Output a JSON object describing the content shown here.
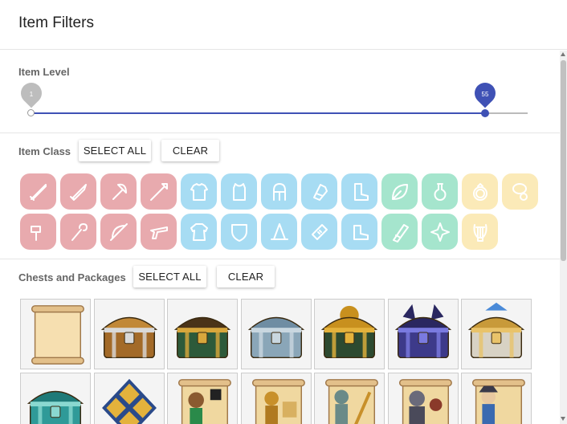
{
  "header": {
    "title": "Item Filters"
  },
  "item_level": {
    "label": "Item Level",
    "min_value": "1",
    "max_value": "55",
    "range_min": 1,
    "range_max": 60
  },
  "item_class": {
    "label": "Item Class",
    "select_all": "SELECT ALL",
    "clear": "CLEAR",
    "icons": [
      {
        "name": "sword-icon",
        "color": "red"
      },
      {
        "name": "dagger-icon",
        "color": "red"
      },
      {
        "name": "axe-icon",
        "color": "red"
      },
      {
        "name": "spear-icon",
        "color": "red"
      },
      {
        "name": "chest-armor-icon",
        "color": "blue"
      },
      {
        "name": "vest-icon",
        "color": "blue"
      },
      {
        "name": "helmet-icon",
        "color": "blue"
      },
      {
        "name": "gauntlet-icon",
        "color": "blue"
      },
      {
        "name": "boot-icon",
        "color": "blue"
      },
      {
        "name": "leaf-icon",
        "color": "green"
      },
      {
        "name": "potion-icon",
        "color": "green"
      },
      {
        "name": "ring-icon",
        "color": "yellow"
      },
      {
        "name": "amulet-icon",
        "color": "yellow"
      },
      {
        "name": "hammer-icon",
        "color": "red"
      },
      {
        "name": "staff-icon",
        "color": "red"
      },
      {
        "name": "bow-icon",
        "color": "red"
      },
      {
        "name": "gun-icon",
        "color": "red"
      },
      {
        "name": "robe-icon",
        "color": "blue"
      },
      {
        "name": "shield-icon",
        "color": "blue"
      },
      {
        "name": "wizard-hat-icon",
        "color": "blue"
      },
      {
        "name": "bandage-icon",
        "color": "blue"
      },
      {
        "name": "shoe-icon",
        "color": "blue"
      },
      {
        "name": "scroll-icon",
        "color": "green"
      },
      {
        "name": "shuriken-icon",
        "color": "green"
      },
      {
        "name": "lyre-icon",
        "color": "yellow"
      }
    ]
  },
  "chests": {
    "label": "Chests and Packages",
    "select_all": "SELECT ALL",
    "clear": "CLEAR",
    "items": [
      {
        "name": "scroll-package-icon"
      },
      {
        "name": "wooden-chest-icon"
      },
      {
        "name": "green-gold-chest-icon"
      },
      {
        "name": "silver-chest-icon"
      },
      {
        "name": "gold-dragon-chest-icon"
      },
      {
        "name": "purple-demon-chest-icon"
      },
      {
        "name": "gold-crown-chest-icon"
      },
      {
        "name": "teal-monster-chest-icon"
      },
      {
        "name": "gold-emblem-chest-icon"
      },
      {
        "name": "hero-scroll-package-icon"
      },
      {
        "name": "golden-warrior-scroll-icon"
      },
      {
        "name": "statue-scroll-icon"
      },
      {
        "name": "dark-knight-scroll-icon"
      },
      {
        "name": "adventurer-scroll-icon"
      }
    ]
  },
  "colors": {
    "accent": "#3f51b5",
    "red": "#e8aaae",
    "blue": "#a7dcf3",
    "green": "#a5e5cd",
    "yellow": "#fbeab8"
  }
}
